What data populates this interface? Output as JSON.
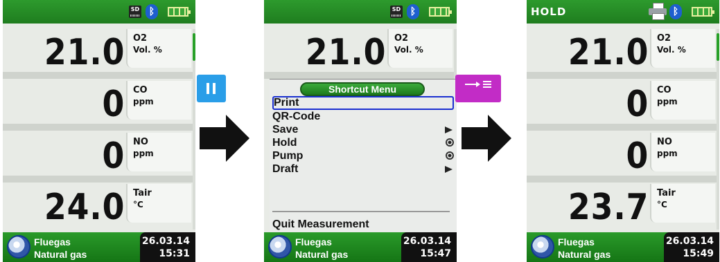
{
  "screens": [
    {
      "hold_label": "",
      "status_icons": [
        "sd-card-icon",
        "bluetooth-icon",
        "battery-icon"
      ],
      "readings": [
        {
          "value": "21.0",
          "gas": "O2",
          "unit": "Vol. %"
        },
        {
          "value": "0",
          "gas": "CO",
          "unit": "ppm"
        },
        {
          "value": "0",
          "gas": "NO",
          "unit": "ppm"
        },
        {
          "value": "24.0",
          "gas": "Tair",
          "unit": "°C"
        }
      ],
      "fuel_line1": "Fluegas",
      "fuel_line2": "Natural gas",
      "date": "26.03.14",
      "time": "15:31"
    },
    {
      "status_icons": [
        "sd-card-icon",
        "bluetooth-icon",
        "battery-icon"
      ],
      "reading": {
        "value": "21.0",
        "gas": "O2",
        "unit": "Vol. %"
      },
      "menu": {
        "title": "Shortcut Menu",
        "items": [
          "Print",
          "QR-Code",
          "Save",
          "Hold",
          "Pump",
          "Draft"
        ],
        "selected": "Print",
        "quit": "Quit Measurement"
      },
      "fuel_line1": "Fluegas",
      "fuel_line2": "Natural gas",
      "date": "26.03.14",
      "time": "15:47"
    },
    {
      "hold_label": "HOLD",
      "status_icons": [
        "printer-icon",
        "bluetooth-icon",
        "battery-icon"
      ],
      "readings": [
        {
          "value": "21.0",
          "gas": "O2",
          "unit": "Vol. %"
        },
        {
          "value": "0",
          "gas": "CO",
          "unit": "ppm"
        },
        {
          "value": "0",
          "gas": "NO",
          "unit": "ppm"
        },
        {
          "value": "23.7",
          "gas": "Tair",
          "unit": "°C"
        }
      ],
      "fuel_line1": "Fluegas",
      "fuel_line2": "Natural gas",
      "date": "26.03.14",
      "time": "15:49"
    }
  ],
  "colors": {
    "accent_green": "#1f7d1f",
    "pause_key": "#2a9ee8",
    "print_key": "#c22cc6",
    "selection": "#1a2fd0"
  },
  "keys": {
    "pause_icon": "pause-icon",
    "print_icon": "arrow-to-list-icon"
  }
}
